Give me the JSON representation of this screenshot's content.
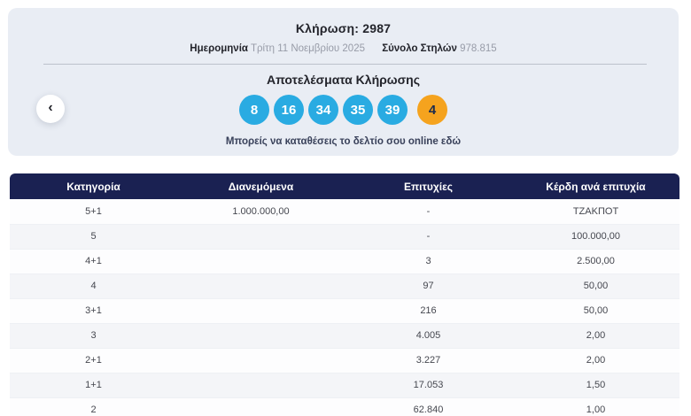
{
  "header": {
    "title": "Κλήρωση: 2987",
    "date_label": "Ημερομηνία",
    "date_value": "Τρίτη 11 Νοεμβρίου 2025",
    "columns_label": "Σύνολο Στηλών",
    "columns_value": "978.815"
  },
  "results": {
    "heading": "Αποτελέσματα Κλήρωσης",
    "numbers": [
      "8",
      "16",
      "34",
      "35",
      "39"
    ],
    "bonus_number": "4",
    "link_text": "Μπορείς να καταθέσεις το δελτίο σου online εδώ",
    "prev_icon": "chevron-left",
    "prev_glyph": "‹"
  },
  "colors": {
    "panel_background": "#e9edf4",
    "ball_blue": "#29abe2",
    "ball_bonus_orange": "#f5a31e",
    "table_header_navy": "#1a2152",
    "row_alt_gray": "#f4f5f8"
  },
  "table": {
    "headers": [
      "Κατηγορία",
      "Διανεμόμενα",
      "Επιτυχίες",
      "Κέρδη ανά επιτυχία"
    ],
    "rows": [
      {
        "category": "5+1",
        "distributed": "1.000.000,00",
        "winners": "-",
        "prize": "ΤΖΑΚΠΟΤ"
      },
      {
        "category": "5",
        "distributed": "",
        "winners": "-",
        "prize": "100.000,00"
      },
      {
        "category": "4+1",
        "distributed": "",
        "winners": "3",
        "prize": "2.500,00"
      },
      {
        "category": "4",
        "distributed": "",
        "winners": "97",
        "prize": "50,00"
      },
      {
        "category": "3+1",
        "distributed": "",
        "winners": "216",
        "prize": "50,00"
      },
      {
        "category": "3",
        "distributed": "",
        "winners": "4.005",
        "prize": "2,00"
      },
      {
        "category": "2+1",
        "distributed": "",
        "winners": "3.227",
        "prize": "2,00"
      },
      {
        "category": "1+1",
        "distributed": "",
        "winners": "17.053",
        "prize": "1,50"
      },
      {
        "category": "2",
        "distributed": "",
        "winners": "62.840",
        "prize": "1,00"
      }
    ]
  }
}
